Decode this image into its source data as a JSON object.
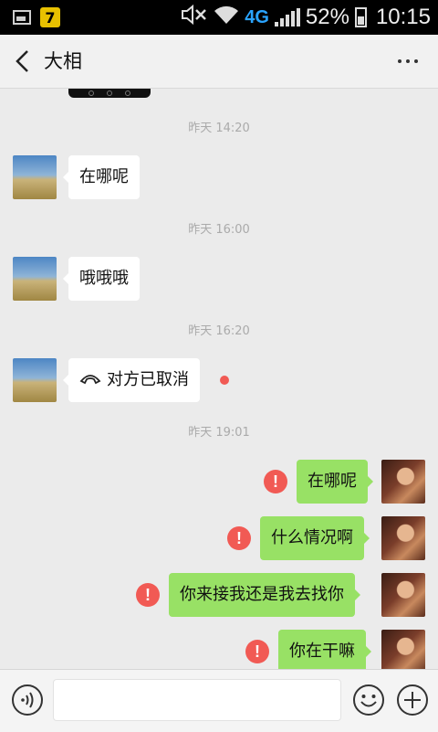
{
  "status_bar": {
    "icons": [
      "gallery-icon",
      "app-7-icon",
      "mute-icon",
      "wifi-icon",
      "signal-icon",
      "battery-icon"
    ],
    "app_badge": "7",
    "network": "4G",
    "battery": "52%",
    "battery_level": 0.52,
    "time": "10:15"
  },
  "header": {
    "title": "大相",
    "back_icon": "back-chevron-icon",
    "more_icon": "more-dots-icon"
  },
  "colors": {
    "sent_bubble": "#98e165",
    "received_bubble": "#ffffff",
    "error": "#f15a54",
    "background": "#ebebeb"
  },
  "messages": {
    "ts1": "昨天 14:20",
    "m1": "在哪呢",
    "ts2": "昨天 16:00",
    "m2": "哦哦哦",
    "ts3": "昨天 16:20",
    "m3": "对方已取消",
    "ts4": "昨天 19:01",
    "m4": "在哪呢",
    "m5": "什么情况啊",
    "m6": "你来接我还是我去找你",
    "m7": "你在干嘛"
  },
  "error_mark": "!",
  "input_bar": {
    "icons": [
      "voice-icon",
      "emoji-icon",
      "plus-icon"
    ],
    "text": ""
  }
}
